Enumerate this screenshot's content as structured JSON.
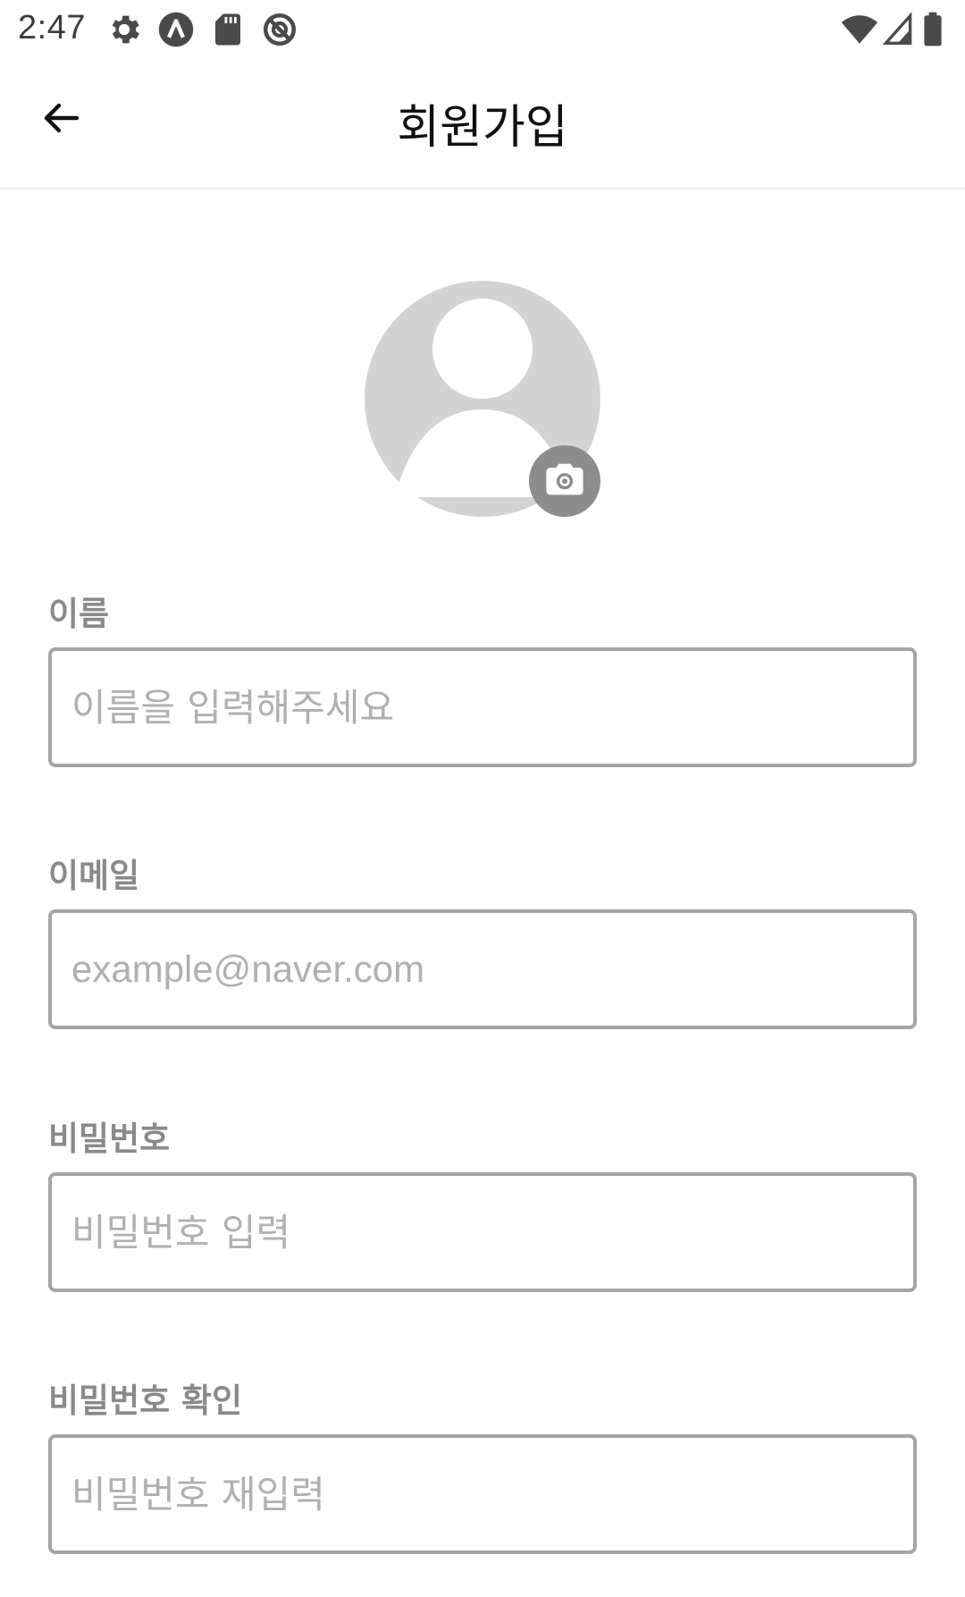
{
  "status_bar": {
    "time": "2:47",
    "left_icons": [
      "settings-icon",
      "a-app-icon",
      "sd-card-icon",
      "no-sync-icon"
    ],
    "right_icons": [
      "wifi-icon",
      "signal-icon",
      "battery-icon"
    ]
  },
  "app_bar": {
    "title": "회원가입",
    "back_icon": "arrow-back-icon"
  },
  "profile": {
    "avatar_icon": "person-placeholder-icon",
    "camera_icon": "camera-icon"
  },
  "form": {
    "name": {
      "label": "이름",
      "placeholder": "이름을 입력해주세요",
      "value": ""
    },
    "email": {
      "label": "이메일",
      "placeholder": "example@naver.com",
      "value": ""
    },
    "password": {
      "label": "비밀번호",
      "placeholder": "비밀번호 입력",
      "value": ""
    },
    "password_confirm": {
      "label": "비밀번호 확인",
      "placeholder": "비밀번호 재입력",
      "value": ""
    }
  },
  "colors": {
    "label": "#8a8a8a",
    "border": "#a5a5a5",
    "placeholder": "#b0b0b0",
    "avatar_bg": "#d3d3d3",
    "camera_bg": "#8d8d8d"
  }
}
